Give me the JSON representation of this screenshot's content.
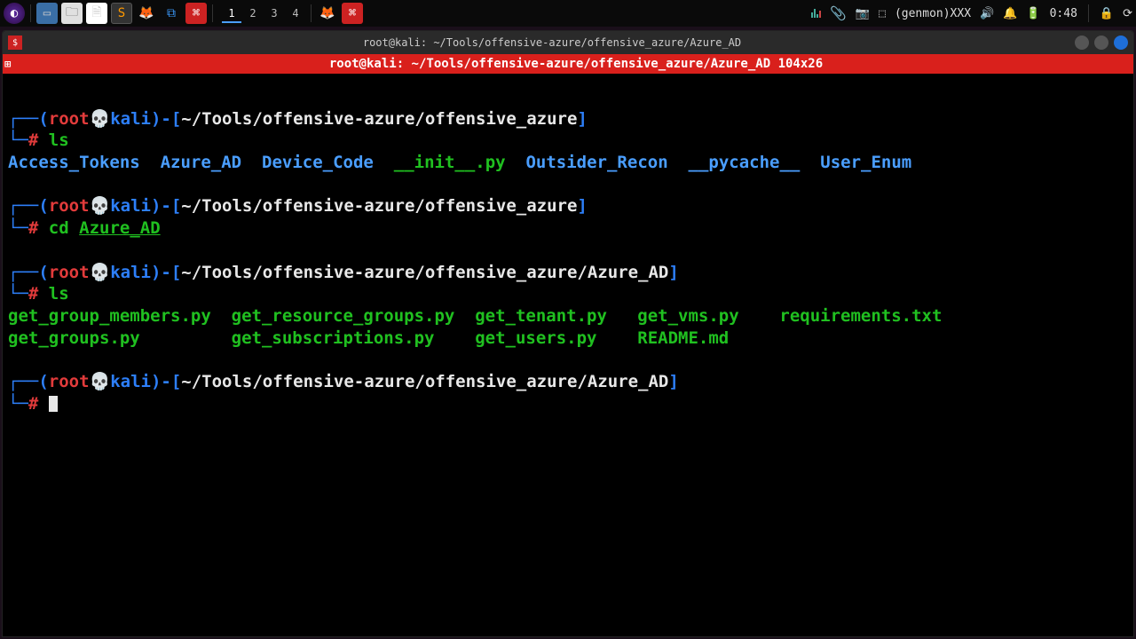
{
  "panel": {
    "workspaces": [
      "1",
      "2",
      "3",
      "4"
    ],
    "active_workspace": 0,
    "tray": {
      "genmon": "(genmon)XXX",
      "clock": "0:48"
    }
  },
  "window": {
    "title": "root@kali: ~/Tools/offensive-azure/offensive_azure/Azure_AD",
    "tmux_title": "root@kali: ~/Tools/offensive-azure/offensive_azure/Azure_AD 104x26"
  },
  "term": {
    "user": "root",
    "skull": "💀",
    "host": "kali",
    "path1": "~/Tools/offensive-azure/offensive_azure",
    "path2": "~/Tools/offensive-azure/offensive_azure/Azure_AD",
    "cmd_ls": "ls",
    "cmd_cd": "cd ",
    "cd_arg": "Azure_AD",
    "ls1": {
      "items": [
        "Access_Tokens",
        "Azure_AD",
        "Device_Code",
        "__init__.py",
        "Outsider_Recon",
        "__pycache__",
        "User_Enum"
      ]
    },
    "ls2_rows": [
      [
        "get_group_members.py",
        "get_resource_groups.py",
        "get_tenant.py",
        "get_vms.py",
        "requirements.txt"
      ],
      [
        "get_groups.py",
        "get_subscriptions.py",
        "get_users.py",
        "README.md",
        ""
      ]
    ]
  }
}
